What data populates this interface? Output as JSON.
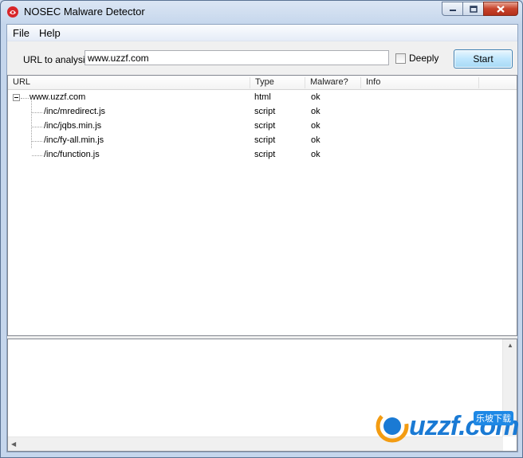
{
  "window": {
    "title": "NOSEC Malware Detector"
  },
  "menu": {
    "file": "File",
    "help": "Help"
  },
  "toolbar": {
    "url_label": "URL to analysis",
    "url_value": "www.uzzf.com",
    "deeply_label": "Deeply",
    "deeply_checked": false,
    "start_label": "Start"
  },
  "tree": {
    "columns": [
      "URL",
      "Type",
      "Malware?",
      "Info"
    ],
    "root": {
      "url": "www.uzzf.com",
      "type": "html",
      "malware": "ok",
      "info": ""
    },
    "children": [
      {
        "url": "/inc/mredirect.js",
        "type": "script",
        "malware": "ok",
        "info": ""
      },
      {
        "url": "/inc/jqbs.min.js",
        "type": "script",
        "malware": "ok",
        "info": ""
      },
      {
        "url": "/inc/fy-all.min.js",
        "type": "script",
        "malware": "ok",
        "info": ""
      },
      {
        "url": "/inc/function.js",
        "type": "script",
        "malware": "ok",
        "info": ""
      }
    ]
  },
  "watermark": {
    "text": "uzzf.com",
    "badge": "乐坡下载"
  },
  "colors": {
    "accent": "#1a7ad4",
    "close": "#c7432b",
    "title_bg": "#c5d6ec"
  }
}
